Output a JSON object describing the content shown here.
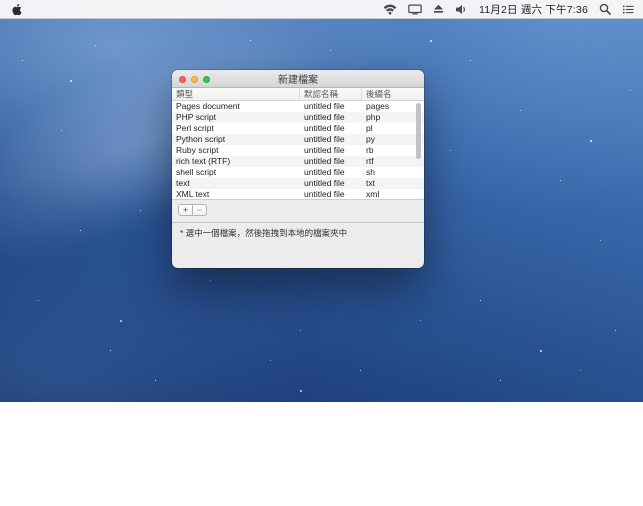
{
  "menu_bar": {
    "clock": "11月2日 週六 下午7:36",
    "status_icons": [
      "wifi",
      "display",
      "eject",
      "volume"
    ],
    "right_icons": [
      "spotlight-search",
      "notification-center"
    ]
  },
  "window": {
    "title": "新建檔案",
    "table": {
      "headers": [
        "類型",
        "默認名稱",
        "後綴名"
      ],
      "rows": [
        {
          "type": "Pages document",
          "name": "untitled file",
          "ext": "pages"
        },
        {
          "type": "PHP script",
          "name": "untitled file",
          "ext": "php"
        },
        {
          "type": "Perl script",
          "name": "untitled file",
          "ext": "pl"
        },
        {
          "type": "Python script",
          "name": "untitled file",
          "ext": "py"
        },
        {
          "type": "Ruby script",
          "name": "untitled file",
          "ext": "rb"
        },
        {
          "type": "rich text (RTF)",
          "name": "untitled file",
          "ext": "rtf"
        },
        {
          "type": "shell script",
          "name": "untitled file",
          "ext": "sh"
        },
        {
          "type": "text",
          "name": "untitled file",
          "ext": "txt"
        },
        {
          "type": "XML text",
          "name": "untitled file",
          "ext": "xml"
        }
      ]
    },
    "buttons": {
      "add": "+",
      "remove": "−"
    },
    "note": "* 選中一個檔案，然後拖拽到本地的檔案夾中"
  },
  "colors": {
    "traffic_red": "#fc615d",
    "traffic_yellow": "#fdbd40",
    "traffic_green": "#34c84a",
    "menubar_bg": "#f8f8f8",
    "window_bg": "#ececec"
  }
}
